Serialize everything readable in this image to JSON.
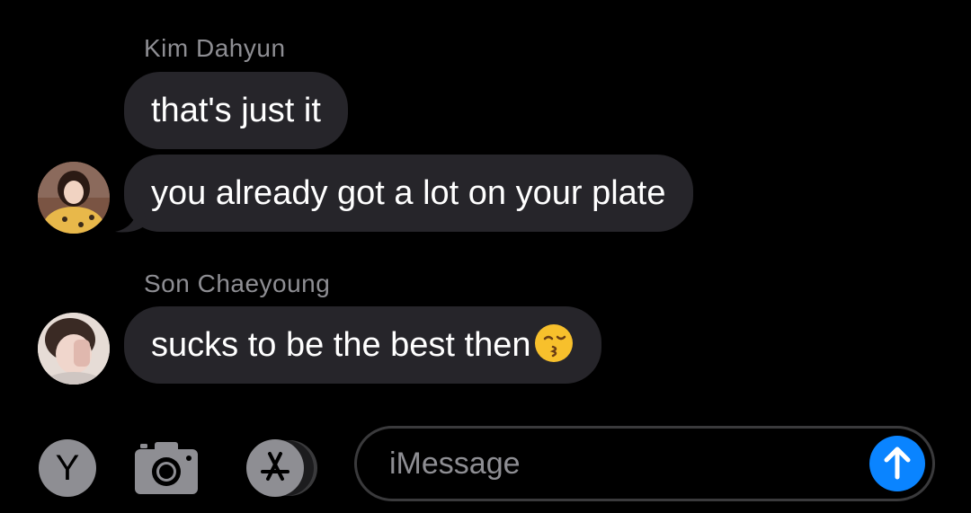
{
  "thread": {
    "groups": [
      {
        "sender": "Kim Dahyun",
        "avatar_icon": "profile-photo-dahyun",
        "messages": [
          "that's just it",
          "you already got a lot on your plate"
        ]
      },
      {
        "sender": "Son Chaeyoung",
        "avatar_icon": "profile-photo-chaeyoung",
        "messages": [
          "sucks to be the best then"
        ],
        "trailing_emoji": "kissing-face-emoji"
      }
    ]
  },
  "composer": {
    "user_initial": "Y",
    "placeholder": "iMessage",
    "icons": [
      "camera-icon",
      "app-store-icon",
      "send-arrow-icon"
    ],
    "send_color": "#0a84ff"
  },
  "colors": {
    "background": "#000000",
    "bubble": "#26252a",
    "sender_text": "#8e8e93"
  }
}
